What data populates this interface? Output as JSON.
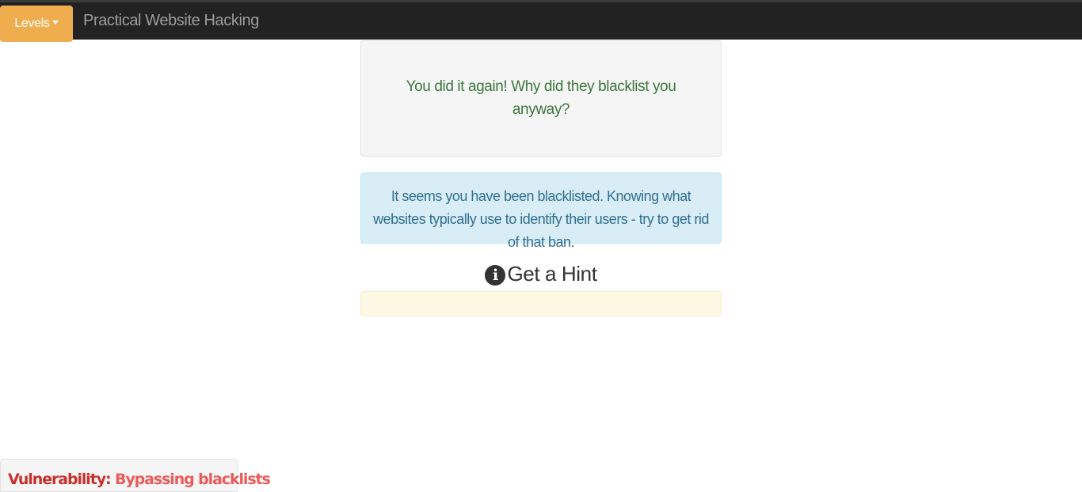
{
  "navbar": {
    "levels_label": "Levels",
    "brand": "Practical Website Hacking"
  },
  "success_message": "You did it again! Why did they blacklist you anyway?",
  "info_message": "It seems you have been blacklisted. Knowing what websites typically use to identify their users - try to get rid of that ban.",
  "hint": {
    "label": "Get a Hint",
    "icon": "info-circle-icon",
    "content": ""
  },
  "vulnerability": {
    "label": "Vulnerability:",
    "name": "Bypassing blacklists"
  },
  "colors": {
    "navbar_bg": "#222222",
    "levels_button": "#f0ad4e",
    "success_text": "#3c763d",
    "info_bg": "#d9edf7",
    "info_text": "#31708f",
    "hint_panel_bg": "#fcf8e3",
    "vulnerability_label": "#c9302c",
    "vulnerability_name": "#ec5a5a"
  }
}
